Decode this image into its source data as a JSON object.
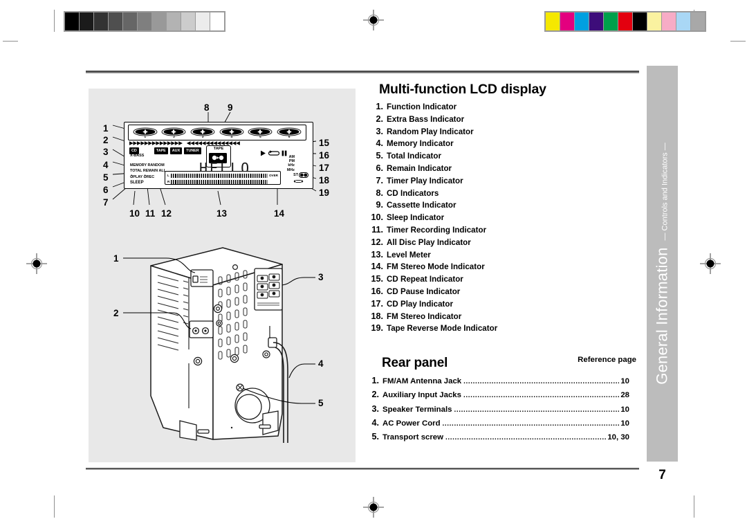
{
  "document": {
    "page_number": "7",
    "sidebar_title": "General Information",
    "sidebar_subtitle": "— Controls and Indicators —"
  },
  "lcd_section": {
    "heading": "Multi-function LCD display",
    "items": [
      {
        "num": "1.",
        "label": "Function Indicator"
      },
      {
        "num": "2.",
        "label": "Extra Bass Indicator"
      },
      {
        "num": "3.",
        "label": "Random Play Indicator"
      },
      {
        "num": "4.",
        "label": "Memory Indicator"
      },
      {
        "num": "5.",
        "label": "Total Indicator"
      },
      {
        "num": "6.",
        "label": "Remain Indicator"
      },
      {
        "num": "7.",
        "label": "Timer Play Indicator"
      },
      {
        "num": "8.",
        "label": "CD Indicators"
      },
      {
        "num": "9.",
        "label": "Cassette Indicator"
      },
      {
        "num": "10.",
        "label": "Sleep Indicator"
      },
      {
        "num": "11.",
        "label": "Timer Recording Indicator"
      },
      {
        "num": "12.",
        "label": "All Disc Play Indicator"
      },
      {
        "num": "13.",
        "label": "Level Meter"
      },
      {
        "num": "14.",
        "label": "FM Stereo Mode Indicator"
      },
      {
        "num": "15.",
        "label": "CD Repeat Indicator"
      },
      {
        "num": "16.",
        "label": "CD Pause Indicator"
      },
      {
        "num": "17.",
        "label": "CD Play Indicator"
      },
      {
        "num": "18.",
        "label": "FM Stereo Indicator"
      },
      {
        "num": "19.",
        "label": "Tape Reverse Mode Indicator"
      }
    ]
  },
  "rear_section": {
    "heading": "Rear panel",
    "reference_header": "Reference page",
    "items": [
      {
        "num": "1.",
        "label": "FM/AM Antenna Jack",
        "page": "10"
      },
      {
        "num": "2.",
        "label": "Auxiliary Input Jacks",
        "page": "28"
      },
      {
        "num": "3.",
        "label": "Speaker Terminals",
        "page": "10"
      },
      {
        "num": "4.",
        "label": "AC Power Cord",
        "page": "10"
      },
      {
        "num": "5.",
        "label": "Transport screw",
        "page": "10, 30"
      }
    ]
  },
  "lcd_diagram": {
    "callouts_left": [
      "1",
      "2",
      "3",
      "4",
      "5",
      "6",
      "7"
    ],
    "callouts_top": [
      "8",
      "9"
    ],
    "callouts_right": [
      "15",
      "16",
      "17",
      "18",
      "19"
    ],
    "callouts_bottom": [
      "10",
      "11",
      "12",
      "13",
      "14"
    ],
    "display_text": "HELLO",
    "source_badges": [
      "CD",
      "TAPE",
      "AUX",
      "TUNER"
    ],
    "extra_bass_label": "X-BASS",
    "memory_label": "MEMORY",
    "random_label": "RANDOM",
    "total_label": "TOTAL",
    "remain_label": "REMAIN",
    "all_label": "ALL",
    "play_label": "PLAY",
    "rec_label": "REC",
    "sleep_label": "SLEEP",
    "tape_label": "TAPE",
    "disc_numbers": [
      "1",
      "2",
      "3",
      "4",
      "5",
      "6"
    ],
    "freq_units": [
      "AM",
      "PM",
      "kHz",
      "MHz"
    ],
    "meter_left_channel": "L",
    "meter_right_channel": "R",
    "meter_over_label": "OVER",
    "stereo_label": "ST",
    "track_arrows_forward": "▶▶▶▶▶▶▶▶▶▶▶▶▶▶",
    "track_arrows_reverse": "◀◀◀◀◀◀◀◀◀◀◀◀◀◀"
  },
  "rear_diagram": {
    "callouts": [
      "1",
      "2",
      "3",
      "4",
      "5"
    ]
  },
  "calibration": {
    "grayscale_wedge": [
      "#000000",
      "#1b1b1b",
      "#333333",
      "#4f4f4f",
      "#666666",
      "#7f7f7f",
      "#999999",
      "#b3b3b3",
      "#cccccc",
      "#ececec",
      "#ffffff"
    ],
    "color_bars": [
      "#f5e800",
      "#e3007f",
      "#00a0e0",
      "#3d0d7a",
      "#00a04b",
      "#e3000f",
      "#000000",
      "#faf2a0",
      "#f7acc6",
      "#a9d7f5",
      "#a8a8a8"
    ]
  }
}
